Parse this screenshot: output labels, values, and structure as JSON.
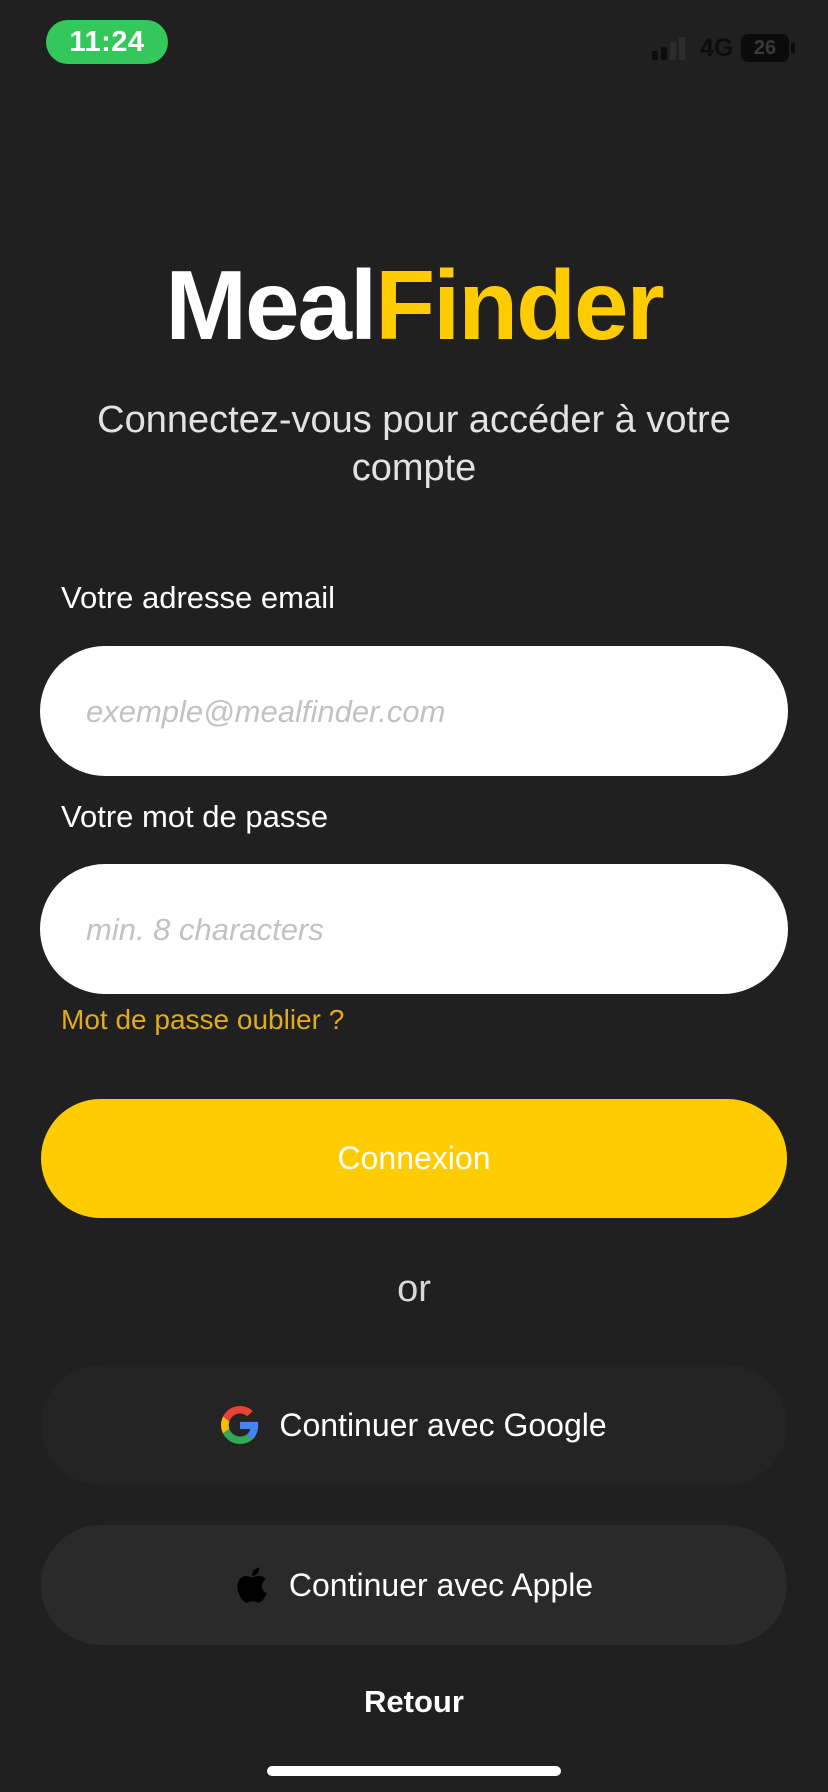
{
  "status_bar": {
    "time": "11:24",
    "network": "4G",
    "battery": "26"
  },
  "logo": {
    "part1": "Meal",
    "part2": "Finder"
  },
  "subtitle": "Connectez-vous pour accéder à votre compte",
  "email": {
    "label": "Votre adresse email",
    "placeholder": "exemple@mealfinder.com",
    "value": ""
  },
  "password": {
    "label": "Votre mot de passe",
    "placeholder": "min. 8 characters",
    "value": ""
  },
  "forgot_password": "Mot de passe oublier ?",
  "login_button": "Connexion",
  "divider_text": "or",
  "google_button": {
    "label": "Continuer avec Google",
    "icon": "google-icon"
  },
  "apple_button": {
    "label": "Continuer avec Apple",
    "icon": "apple-icon"
  },
  "back_link": "Retour",
  "colors": {
    "background": "#202020",
    "accent": "#ffcc00",
    "forgot_link": "#e0ac1a",
    "time_pill": "#34c759"
  }
}
